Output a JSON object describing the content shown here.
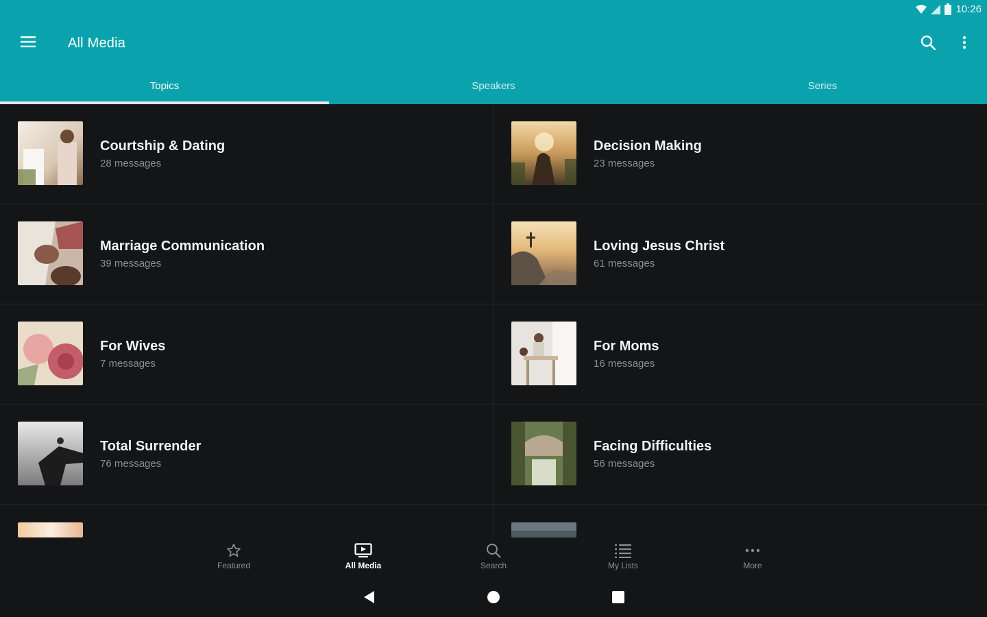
{
  "status_bar": {
    "time": "10:26",
    "icons": [
      "wifi-icon",
      "cell-signal-icon",
      "battery-icon"
    ]
  },
  "app_bar": {
    "title": "All Media",
    "icons": [
      "menu-icon",
      "search-icon",
      "overflow-menu-icon"
    ]
  },
  "tabs": [
    {
      "label": "Topics",
      "active": true
    },
    {
      "label": "Speakers",
      "active": false
    },
    {
      "label": "Series",
      "active": false
    }
  ],
  "topics": [
    {
      "title": "Courtship & Dating",
      "subtitle": "28 messages"
    },
    {
      "title": "Decision Making",
      "subtitle": "23 messages"
    },
    {
      "title": "Marriage Communication",
      "subtitle": "39 messages"
    },
    {
      "title": "Loving Jesus Christ",
      "subtitle": "61 messages"
    },
    {
      "title": "For Wives",
      "subtitle": "7 messages"
    },
    {
      "title": "For Moms",
      "subtitle": "16 messages"
    },
    {
      "title": "Total Surrender",
      "subtitle": "76 messages"
    },
    {
      "title": "Facing Difficulties",
      "subtitle": "56 messages"
    }
  ],
  "bottom_nav": [
    {
      "label": "Featured",
      "icon": "star-icon",
      "active": false
    },
    {
      "label": "All Media",
      "icon": "media-icon",
      "active": true
    },
    {
      "label": "Search",
      "icon": "search-icon",
      "active": false
    },
    {
      "label": "My Lists",
      "icon": "list-icon",
      "active": false
    },
    {
      "label": "More",
      "icon": "more-horiz-icon",
      "active": false
    }
  ],
  "system_nav": [
    "back-icon",
    "home-icon",
    "recents-icon"
  ],
  "colors": {
    "accent": "#0aa3ad",
    "background": "#141517",
    "divider": "#25272a",
    "subtitle": "#8b8f93"
  }
}
